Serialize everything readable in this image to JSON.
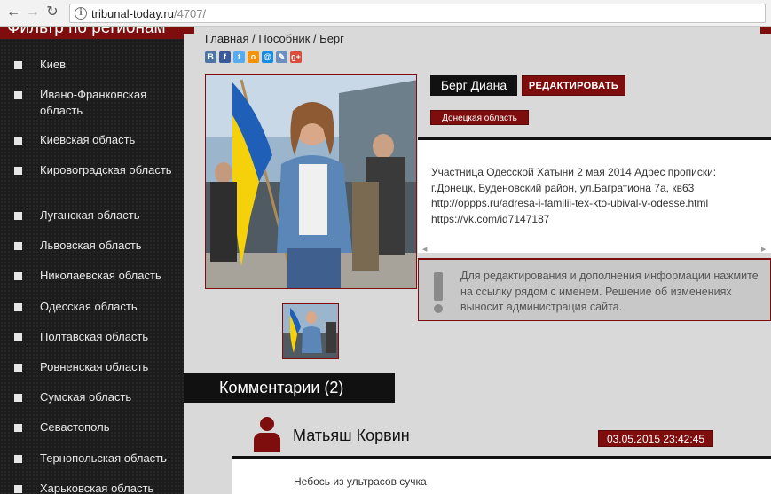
{
  "browser": {
    "url_host": "tribunal-today.ru",
    "url_path": "/4707/"
  },
  "sidebar": {
    "title": "Фильтр по регионам",
    "regions": [
      "Киев",
      "Ивано-Франковская область",
      "Киевская область",
      "Кировоградская область",
      "Луганская область",
      "Львовская область",
      "Николаевская область",
      "Одесская область",
      "Полтавская область",
      "Ровненская область",
      "Сумская область",
      "Севастополь",
      "Тернопольская область",
      "Харьковская область"
    ]
  },
  "breadcrumb": "Главная / Пособник / Берг",
  "share_icons": [
    {
      "name": "vk-icon",
      "glyph": "В",
      "color": "#4c75a3"
    },
    {
      "name": "facebook-icon",
      "glyph": "f",
      "color": "#3b5998"
    },
    {
      "name": "twitter-icon",
      "glyph": "t",
      "color": "#55acee"
    },
    {
      "name": "odnoklassniki-icon",
      "glyph": "о",
      "color": "#f2930b"
    },
    {
      "name": "mail-icon",
      "glyph": "@",
      "color": "#168de2"
    },
    {
      "name": "livejournal-icon",
      "glyph": "✎",
      "color": "#6c8fc1"
    },
    {
      "name": "google-plus-icon",
      "glyph": "g+",
      "color": "#dd4b39"
    }
  ],
  "profile": {
    "name": "Берг Диана",
    "edit_label": "РЕДАКТИРОВАТЬ",
    "region": "Донецкая область",
    "description": "Участница Одесской Хатыни 2 мая 2014 Адрес прописки: г.Донецк, Буденовский район, ул.Багратиона 7а, кв63 http://oppps.ru/adresa-i-familii-tex-kto-ubival-v-odesse.html https://vk.com/id7147187"
  },
  "notice": "Для редактирования и дополнения информации нажмите на ссылку рядом с именем. Решение об изменениях выносит администрация сайта.",
  "comments": {
    "header": "Комментарии (2)",
    "items": [
      {
        "author": "Матьяш Корвин",
        "date": "03.05.2015 23:42:45",
        "text": "Небось из ультрасов сучка"
      }
    ]
  },
  "colors": {
    "accent": "#7e0e0e",
    "sidebar_bg": "#1c1c1c",
    "page_bg": "#d9d9d9"
  }
}
